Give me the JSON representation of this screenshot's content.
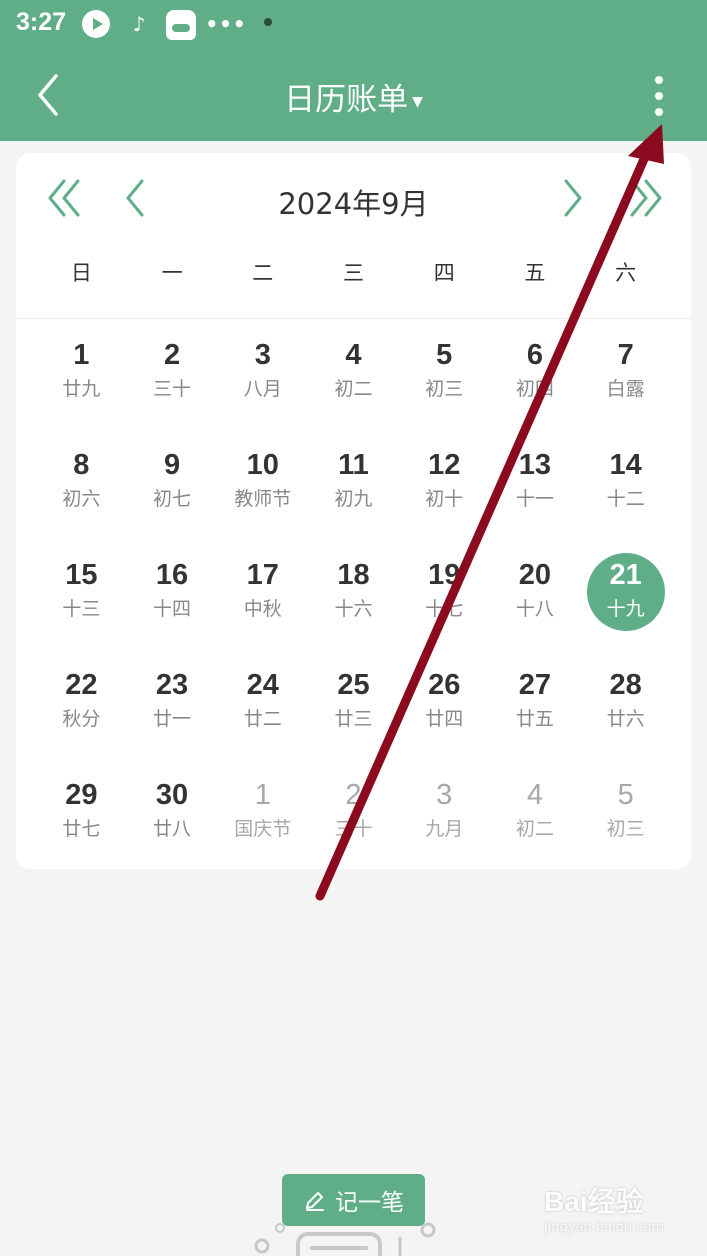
{
  "status_bar": {
    "time": "3:27",
    "more": "•••"
  },
  "header": {
    "title": "日历账单"
  },
  "calendar": {
    "month_label": "2024年9月",
    "weekdays": [
      "日",
      "一",
      "二",
      "三",
      "四",
      "五",
      "六"
    ],
    "days": [
      {
        "num": "1",
        "sub": "廿九"
      },
      {
        "num": "2",
        "sub": "三十"
      },
      {
        "num": "3",
        "sub": "八月"
      },
      {
        "num": "4",
        "sub": "初二"
      },
      {
        "num": "5",
        "sub": "初三"
      },
      {
        "num": "6",
        "sub": "初四"
      },
      {
        "num": "7",
        "sub": "白露"
      },
      {
        "num": "8",
        "sub": "初六"
      },
      {
        "num": "9",
        "sub": "初七"
      },
      {
        "num": "10",
        "sub": "教师节"
      },
      {
        "num": "11",
        "sub": "初九"
      },
      {
        "num": "12",
        "sub": "初十"
      },
      {
        "num": "13",
        "sub": "十一"
      },
      {
        "num": "14",
        "sub": "十二"
      },
      {
        "num": "15",
        "sub": "十三"
      },
      {
        "num": "16",
        "sub": "十四"
      },
      {
        "num": "17",
        "sub": "中秋"
      },
      {
        "num": "18",
        "sub": "十六"
      },
      {
        "num": "19",
        "sub": "十七"
      },
      {
        "num": "20",
        "sub": "十八"
      },
      {
        "num": "21",
        "sub": "十九",
        "selected": true
      },
      {
        "num": "22",
        "sub": "秋分"
      },
      {
        "num": "23",
        "sub": "廿一"
      },
      {
        "num": "24",
        "sub": "廿二"
      },
      {
        "num": "25",
        "sub": "廿三"
      },
      {
        "num": "26",
        "sub": "廿四"
      },
      {
        "num": "27",
        "sub": "廿五"
      },
      {
        "num": "28",
        "sub": "廿六"
      },
      {
        "num": "29",
        "sub": "廿七"
      },
      {
        "num": "30",
        "sub": "廿八"
      },
      {
        "num": "1",
        "sub": "国庆节",
        "other": true
      },
      {
        "num": "2",
        "sub": "三十",
        "other": true
      },
      {
        "num": "3",
        "sub": "九月",
        "other": true
      },
      {
        "num": "4",
        "sub": "初二",
        "other": true
      },
      {
        "num": "5",
        "sub": "初三",
        "other": true
      }
    ]
  },
  "record_button": {
    "label": "记一笔"
  },
  "watermark": {
    "main": "Bai经验",
    "sub": "jingyan.baidu.com"
  },
  "colors": {
    "accent": "#5fae88",
    "background": "#f4f4f4",
    "annotation_arrow": "#8b0a1f"
  }
}
